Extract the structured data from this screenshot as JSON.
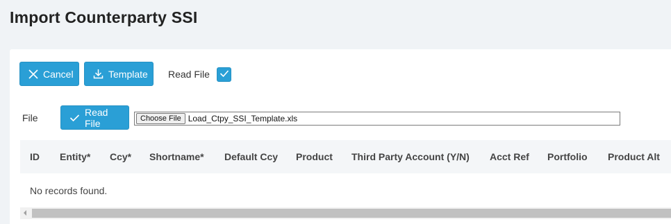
{
  "page": {
    "title": "Import Counterparty SSI"
  },
  "toolbar": {
    "cancel_label": "Cancel",
    "template_label": "Template",
    "read_file_label": "Read File",
    "read_file_checked": true
  },
  "file_row": {
    "label": "File",
    "read_file_button": "Read File",
    "choose_file_label": "Choose File",
    "file_name": "Load_Ctpy_SSI_Template.xls"
  },
  "table": {
    "columns": [
      "ID",
      "Entity*",
      "Ccy*",
      "Shortname*",
      "Default Ccy",
      "Product",
      "Third Party Account (Y/N)",
      "Acct Ref",
      "Portfolio",
      "Product Alt"
    ],
    "empty_message": "No records found."
  },
  "colors": {
    "accent": "#2a9fd6",
    "background": "#f0f3f6"
  },
  "icons": {
    "cancel": "close-icon",
    "template": "download-icon",
    "read_file": "check-icon",
    "checkbox": "check-icon"
  }
}
